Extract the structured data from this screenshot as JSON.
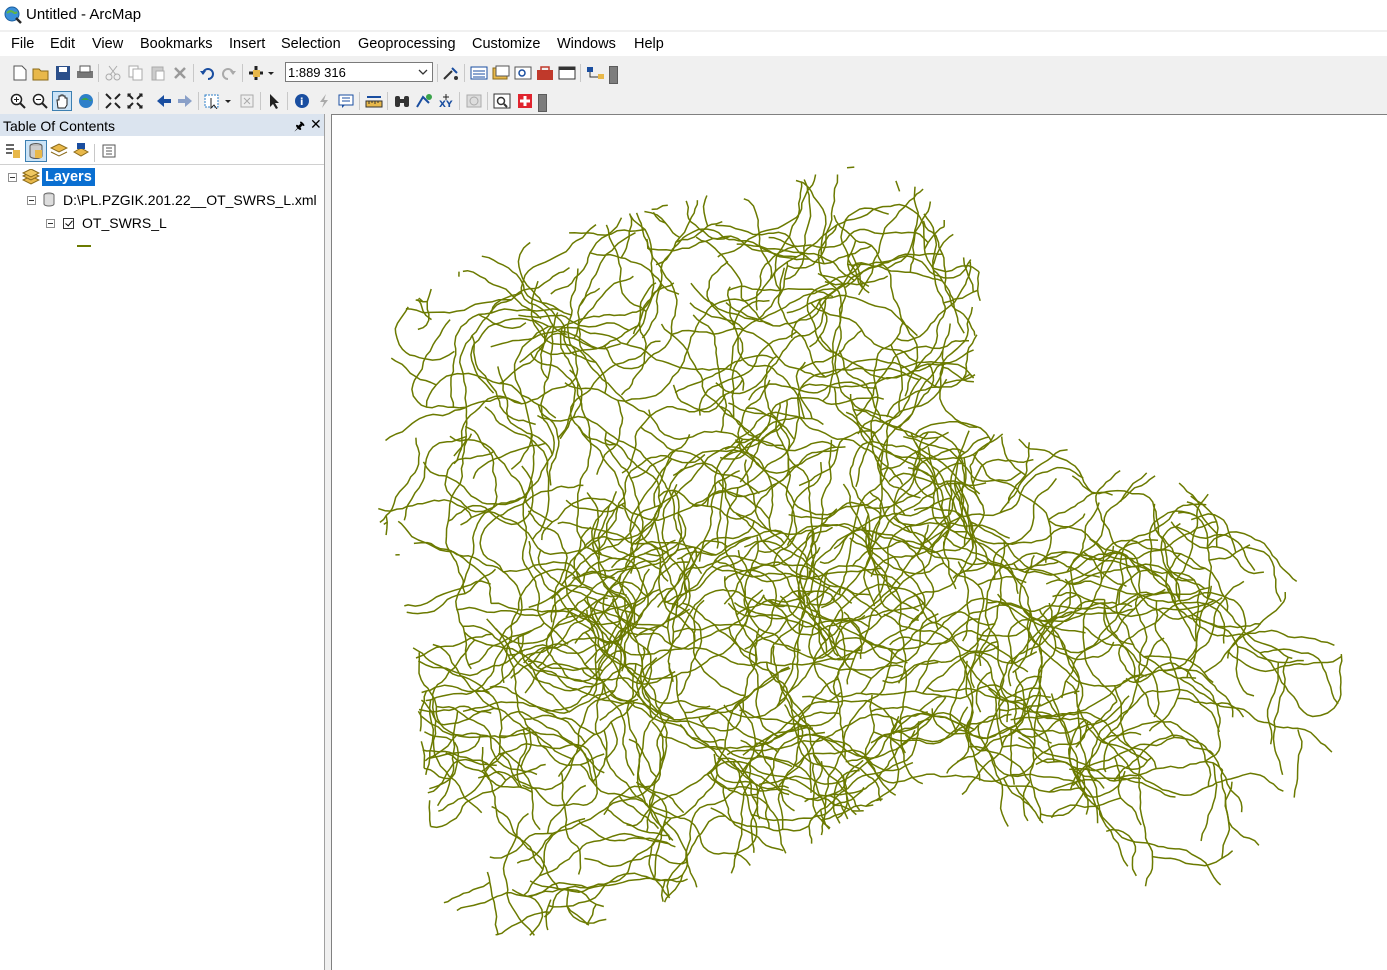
{
  "window": {
    "title": "Untitled - ArcMap",
    "app_icon": "arcmap-globe-icon"
  },
  "menu": [
    "File",
    "Edit",
    "View",
    "Bookmarks",
    "Insert",
    "Selection",
    "Geoprocessing",
    "Customize",
    "Windows",
    "Help"
  ],
  "standard_toolbar": {
    "tools": [
      "new-document-icon",
      "open-icon",
      "save-icon",
      "print-icon",
      "cut-icon",
      "copy-icon",
      "paste-icon",
      "delete-icon",
      "undo-icon",
      "redo-icon",
      "add-data-icon"
    ],
    "scale_value": "1:889 316",
    "tools_after_scale": [
      "editor-toolbar-icon",
      "table-of-contents-icon",
      "catalog-icon",
      "search-icon",
      "arctoolbox-icon",
      "python-icon",
      "model-builder-icon"
    ]
  },
  "tools_toolbar": [
    "zoom-in-icon",
    "zoom-out-icon",
    "pan-icon",
    "full-extent-icon",
    "fixed-zoom-in-icon",
    "fixed-zoom-out-icon",
    "back-icon",
    "forward-icon",
    "select-features-icon",
    "clear-selection-icon",
    "select-elements-icon",
    "identify-icon",
    "hyperlink-icon",
    "html-popup-icon",
    "measure-icon",
    "find-icon",
    "find-route-icon",
    "go-to-xy-icon",
    "time-slider-icon",
    "create-viewer-window-icon",
    "swipe-icon"
  ],
  "toc": {
    "title": "Table Of Contents",
    "tools": [
      "list-by-drawing-order-icon",
      "list-by-source-icon",
      "list-by-visibility-icon",
      "list-by-selection-icon",
      "options-icon"
    ],
    "root_label": "Layers",
    "source_label": "D:\\PL.PZGIK.201.22__OT_SWRS_L.xml",
    "layer_label": "OT_SWRS_L",
    "layer_checked": true
  },
  "map": {
    "line_color": "#6b7a00",
    "feature": "river network polylines"
  }
}
